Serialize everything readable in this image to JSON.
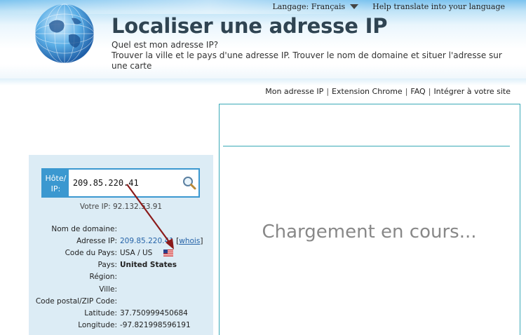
{
  "topbar": {
    "language_label": "Langage: Français",
    "help_translate": "Help translate into your language"
  },
  "header": {
    "title": "Localiser une adresse IP",
    "subtitle_line1": "Quel est mon adresse IP?",
    "subtitle_line2": "Trouver la ville et le pays d'une adresse IP. Trouver le nom de domaine et situer l'adresse sur une carte"
  },
  "nav": {
    "items": [
      "Mon adresse IP",
      "Extension Chrome",
      "FAQ",
      "Intégrer à votre site"
    ],
    "separator": "|"
  },
  "lookup": {
    "host_label": "Hôte/ IP:",
    "host_value": "209.85.220.41",
    "your_ip": "Votre IP: 92.132.53.91"
  },
  "info": {
    "domain_label": "Nom de domaine:",
    "domain_value": "",
    "ip_label": "Adresse IP:",
    "ip_value": "209.85.220.41",
    "whois_label": "whois",
    "country_code_label": "Code du Pays:",
    "country_code_value": "USA / US",
    "country_label": "Pays:",
    "country_value": "United States",
    "region_label": "Région:",
    "region_value": "",
    "city_label": "Ville:",
    "city_value": "",
    "zip_label": "Code postal/ZIP Code:",
    "zip_value": "",
    "lat_label": "Latitude:",
    "lat_value": "37.750999450684",
    "lon_label": "Longitude:",
    "lon_value": "-97.821998596191"
  },
  "map": {
    "loading_text": "Chargement en cours..."
  },
  "colors": {
    "accent": "#3b98d0",
    "panel_bg": "#dcecf5",
    "map_border": "#3aa9b7",
    "arrow": "#8b1a1a"
  }
}
